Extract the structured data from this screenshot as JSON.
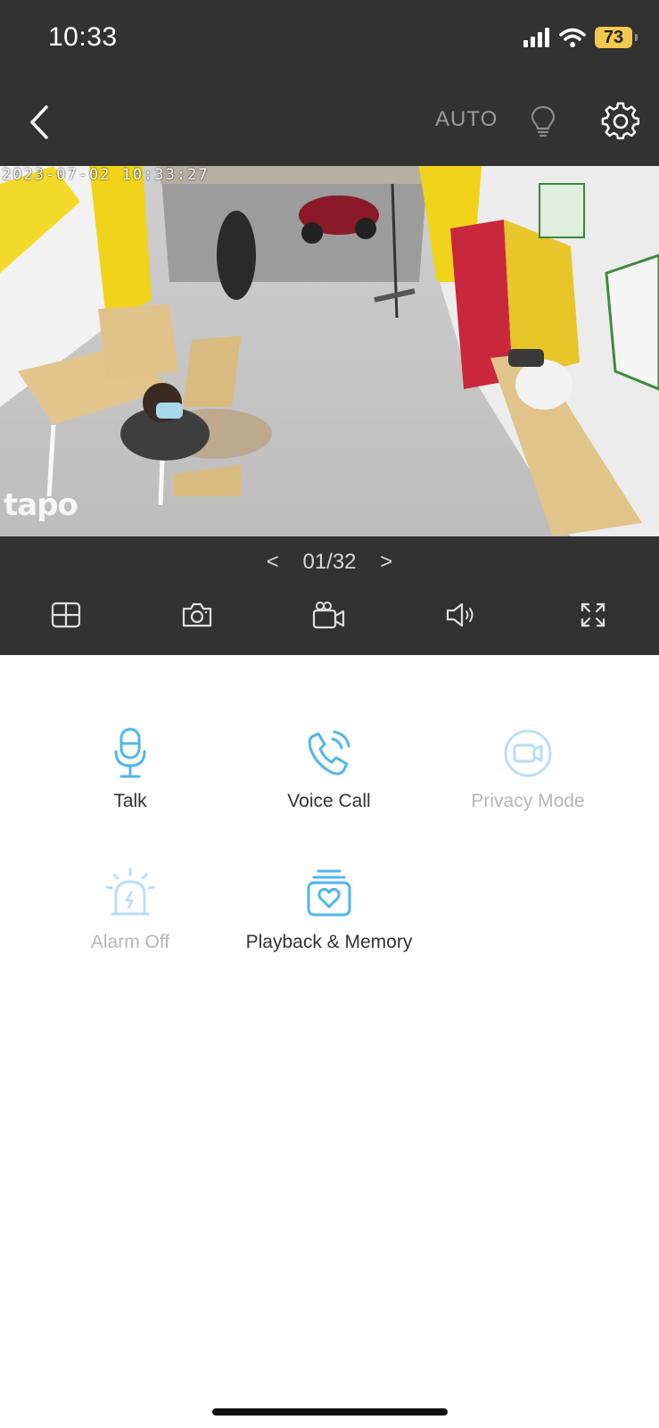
{
  "status_bar": {
    "time": "10:33",
    "battery": "73"
  },
  "header": {
    "auto_label": "AUTO"
  },
  "camera": {
    "timestamp": "2023-07-02  10:33:27",
    "watermark": "tapo"
  },
  "pager": {
    "prev": "<",
    "current": "01/32",
    "next": ">"
  },
  "actions": [
    {
      "label": "Talk",
      "icon": "microphone-icon",
      "enabled": true
    },
    {
      "label": "Voice Call",
      "icon": "phone-call-icon",
      "enabled": true
    },
    {
      "label": "Privacy Mode",
      "icon": "privacy-camera-icon",
      "enabled": false
    },
    {
      "label": "Alarm Off",
      "icon": "alarm-siren-icon",
      "enabled": false
    },
    {
      "label": "Playback & Memory",
      "icon": "playback-memory-icon",
      "enabled": true
    }
  ],
  "colors": {
    "accent": "#4fb6ec",
    "accent_disabled": "#b8dff4",
    "bar_background": "#323232"
  }
}
